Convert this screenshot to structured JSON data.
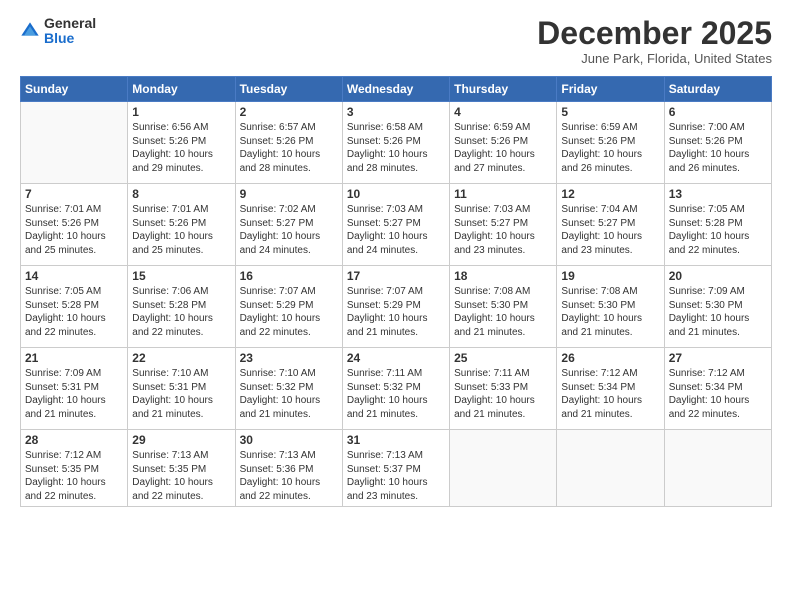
{
  "logo": {
    "general": "General",
    "blue": "Blue"
  },
  "title": "December 2025",
  "location": "June Park, Florida, United States",
  "days_of_week": [
    "Sunday",
    "Monday",
    "Tuesday",
    "Wednesday",
    "Thursday",
    "Friday",
    "Saturday"
  ],
  "weeks": [
    [
      {
        "day": "",
        "info": ""
      },
      {
        "day": "1",
        "info": "Sunrise: 6:56 AM\nSunset: 5:26 PM\nDaylight: 10 hours\nand 29 minutes."
      },
      {
        "day": "2",
        "info": "Sunrise: 6:57 AM\nSunset: 5:26 PM\nDaylight: 10 hours\nand 28 minutes."
      },
      {
        "day": "3",
        "info": "Sunrise: 6:58 AM\nSunset: 5:26 PM\nDaylight: 10 hours\nand 28 minutes."
      },
      {
        "day": "4",
        "info": "Sunrise: 6:59 AM\nSunset: 5:26 PM\nDaylight: 10 hours\nand 27 minutes."
      },
      {
        "day": "5",
        "info": "Sunrise: 6:59 AM\nSunset: 5:26 PM\nDaylight: 10 hours\nand 26 minutes."
      },
      {
        "day": "6",
        "info": "Sunrise: 7:00 AM\nSunset: 5:26 PM\nDaylight: 10 hours\nand 26 minutes."
      }
    ],
    [
      {
        "day": "7",
        "info": "Sunrise: 7:01 AM\nSunset: 5:26 PM\nDaylight: 10 hours\nand 25 minutes."
      },
      {
        "day": "8",
        "info": "Sunrise: 7:01 AM\nSunset: 5:26 PM\nDaylight: 10 hours\nand 25 minutes."
      },
      {
        "day": "9",
        "info": "Sunrise: 7:02 AM\nSunset: 5:27 PM\nDaylight: 10 hours\nand 24 minutes."
      },
      {
        "day": "10",
        "info": "Sunrise: 7:03 AM\nSunset: 5:27 PM\nDaylight: 10 hours\nand 24 minutes."
      },
      {
        "day": "11",
        "info": "Sunrise: 7:03 AM\nSunset: 5:27 PM\nDaylight: 10 hours\nand 23 minutes."
      },
      {
        "day": "12",
        "info": "Sunrise: 7:04 AM\nSunset: 5:27 PM\nDaylight: 10 hours\nand 23 minutes."
      },
      {
        "day": "13",
        "info": "Sunrise: 7:05 AM\nSunset: 5:28 PM\nDaylight: 10 hours\nand 22 minutes."
      }
    ],
    [
      {
        "day": "14",
        "info": "Sunrise: 7:05 AM\nSunset: 5:28 PM\nDaylight: 10 hours\nand 22 minutes."
      },
      {
        "day": "15",
        "info": "Sunrise: 7:06 AM\nSunset: 5:28 PM\nDaylight: 10 hours\nand 22 minutes."
      },
      {
        "day": "16",
        "info": "Sunrise: 7:07 AM\nSunset: 5:29 PM\nDaylight: 10 hours\nand 22 minutes."
      },
      {
        "day": "17",
        "info": "Sunrise: 7:07 AM\nSunset: 5:29 PM\nDaylight: 10 hours\nand 21 minutes."
      },
      {
        "day": "18",
        "info": "Sunrise: 7:08 AM\nSunset: 5:30 PM\nDaylight: 10 hours\nand 21 minutes."
      },
      {
        "day": "19",
        "info": "Sunrise: 7:08 AM\nSunset: 5:30 PM\nDaylight: 10 hours\nand 21 minutes."
      },
      {
        "day": "20",
        "info": "Sunrise: 7:09 AM\nSunset: 5:30 PM\nDaylight: 10 hours\nand 21 minutes."
      }
    ],
    [
      {
        "day": "21",
        "info": "Sunrise: 7:09 AM\nSunset: 5:31 PM\nDaylight: 10 hours\nand 21 minutes."
      },
      {
        "day": "22",
        "info": "Sunrise: 7:10 AM\nSunset: 5:31 PM\nDaylight: 10 hours\nand 21 minutes."
      },
      {
        "day": "23",
        "info": "Sunrise: 7:10 AM\nSunset: 5:32 PM\nDaylight: 10 hours\nand 21 minutes."
      },
      {
        "day": "24",
        "info": "Sunrise: 7:11 AM\nSunset: 5:32 PM\nDaylight: 10 hours\nand 21 minutes."
      },
      {
        "day": "25",
        "info": "Sunrise: 7:11 AM\nSunset: 5:33 PM\nDaylight: 10 hours\nand 21 minutes."
      },
      {
        "day": "26",
        "info": "Sunrise: 7:12 AM\nSunset: 5:34 PM\nDaylight: 10 hours\nand 21 minutes."
      },
      {
        "day": "27",
        "info": "Sunrise: 7:12 AM\nSunset: 5:34 PM\nDaylight: 10 hours\nand 22 minutes."
      }
    ],
    [
      {
        "day": "28",
        "info": "Sunrise: 7:12 AM\nSunset: 5:35 PM\nDaylight: 10 hours\nand 22 minutes."
      },
      {
        "day": "29",
        "info": "Sunrise: 7:13 AM\nSunset: 5:35 PM\nDaylight: 10 hours\nand 22 minutes."
      },
      {
        "day": "30",
        "info": "Sunrise: 7:13 AM\nSunset: 5:36 PM\nDaylight: 10 hours\nand 22 minutes."
      },
      {
        "day": "31",
        "info": "Sunrise: 7:13 AM\nSunset: 5:37 PM\nDaylight: 10 hours\nand 23 minutes."
      },
      {
        "day": "",
        "info": ""
      },
      {
        "day": "",
        "info": ""
      },
      {
        "day": "",
        "info": ""
      }
    ]
  ]
}
